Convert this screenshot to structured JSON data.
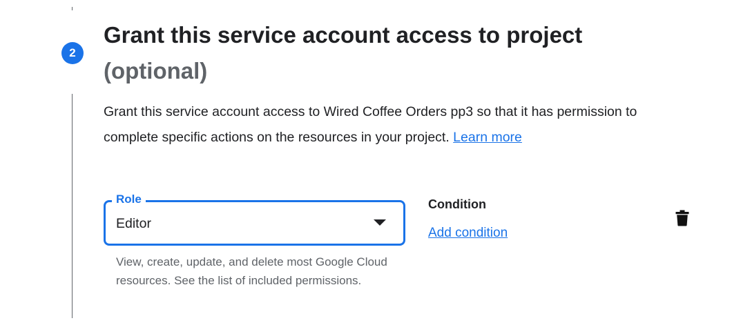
{
  "step": {
    "number": "2",
    "title": "Grant this service account access to project",
    "subtitle": "(optional)"
  },
  "description": {
    "text": "Grant this service account access to Wired Coffee Orders pp3 so that it has permission to complete specific actions on the resources in your project. ",
    "learn_more_label": "Learn more"
  },
  "role": {
    "label": "Role",
    "value": "Editor",
    "help_text": "View, create, update, and delete most Google Cloud resources. See the list of included permissions."
  },
  "condition": {
    "title": "Condition",
    "add_label": "Add condition"
  },
  "icons": {
    "delete": "trash-icon",
    "dropdown": "dropdown-arrow-icon"
  },
  "colors": {
    "accent": "#1a73e8",
    "text_primary": "#202124",
    "text_secondary": "#5f6368"
  }
}
